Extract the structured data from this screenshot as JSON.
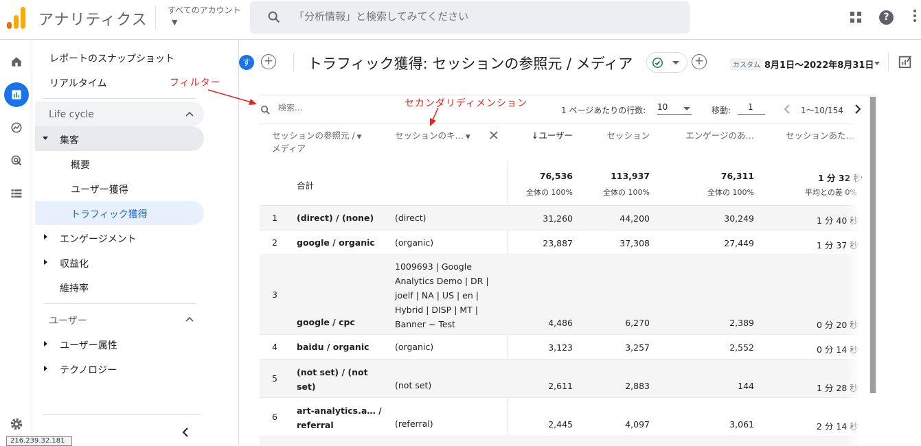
{
  "app": {
    "title": "アナリティクス",
    "account_label": "すべてのアカウント",
    "search_placeholder": "「分析情報」と検索してみてください",
    "help_label": "?"
  },
  "ip_address": "216.239.32.181",
  "nav": {
    "snapshot": "レポートのスナップショット",
    "realtime": "リアルタイム",
    "lifecycle": {
      "title": "Life cycle",
      "acquisition": "集客",
      "acquisition_children": [
        "概要",
        "ユーザー獲得",
        "トラフィック獲得"
      ],
      "engagement": "エンゲージメント",
      "monetization": "収益化",
      "retention": "維持率"
    },
    "user": {
      "title": "ユーザー",
      "attributes": "ユーザー属性",
      "technology": "テクノロジー"
    }
  },
  "report": {
    "avatar_letter": "す",
    "title": "トラフィック獲得: セッションの参照元 / メディア",
    "custom_tag": "カスタム",
    "date_range": "8月1日〜2022年8月31日"
  },
  "table": {
    "search_placeholder": "検索...",
    "rows_per_page_label": "1 ページあたりの行数:",
    "rows_per_page": "10",
    "goto_label": "移動:",
    "goto_value": "1",
    "page_range": "1〜10/154",
    "headers": {
      "source_medium_line1": "セッションの参照元 /",
      "source_medium_line2": "メディア",
      "secondary": "セッションのキ…",
      "users": "ユーザー",
      "sessions": "セッション",
      "engaged": "エンゲージのあ…",
      "avg": "セッションあた…"
    },
    "totals": {
      "label": "合計",
      "users": "76,536",
      "users_sub": "全体の 100%",
      "sessions": "113,937",
      "sessions_sub": "全体の 100%",
      "engaged": "76,311",
      "engaged_sub": "全体の 100%",
      "avg": "1 分 32 秒",
      "avg_sub": "平均との差 0%"
    },
    "rows": [
      {
        "idx": "1",
        "source": "(direct) / (none)",
        "secondary": "(direct)",
        "users": "31,260",
        "sessions": "44,200",
        "engaged": "30,249",
        "avg": "1 分 40 秒"
      },
      {
        "idx": "2",
        "source": "google / organic",
        "secondary": "(organic)",
        "users": "23,887",
        "sessions": "37,308",
        "engaged": "27,449",
        "avg": "1 分 37 秒"
      },
      {
        "idx": "3",
        "source": "google / cpc",
        "secondary_lines": [
          "1009693 | Google",
          "Analytics Demo | DR |",
          "joelf | NA | US | en |",
          "Hybrid | DISP | MT |",
          "Banner ~ Test"
        ],
        "users": "4,486",
        "sessions": "6,270",
        "engaged": "2,389",
        "avg": "0 分 20 秒"
      },
      {
        "idx": "4",
        "source": "baidu / organic",
        "secondary": "(organic)",
        "users": "3,123",
        "sessions": "3,257",
        "engaged": "2,552",
        "avg": "0 分 14 秒"
      },
      {
        "idx": "5",
        "source_lines": [
          "(not set) / (not",
          "set)"
        ],
        "secondary": "(not set)",
        "users": "2,611",
        "sessions": "2,883",
        "engaged": "144",
        "avg": "1 分 28 秒"
      },
      {
        "idx": "6",
        "source_lines": [
          "art-analytics.a… /",
          "referral"
        ],
        "secondary": "(referral)",
        "users": "2,445",
        "sessions": "4,097",
        "engaged": "3,061",
        "avg": "2 分 14 秒"
      }
    ]
  },
  "annotations": {
    "filter": "フィルター",
    "secondary_dimension": "セカンダリディメンション"
  },
  "colors": {
    "accent_blue": "#1a73e8",
    "logo_orange": "#f9ab00",
    "logo_dark_orange": "#e37400",
    "annotation_red": "#e8251d",
    "check_green": "#188038"
  },
  "icons": [
    "analytics-logo-icon",
    "search-icon",
    "apps-grid-icon",
    "help-icon",
    "more-vert-icon",
    "home-icon",
    "reports-icon",
    "explore-icon",
    "advertising-icon",
    "configure-icon",
    "settings-icon",
    "collapse-chevron-icon",
    "add-comparison-icon",
    "check-circle-icon",
    "calendar-caret-icon",
    "edit-report-icon",
    "close-icon",
    "sort-down-icon"
  ]
}
